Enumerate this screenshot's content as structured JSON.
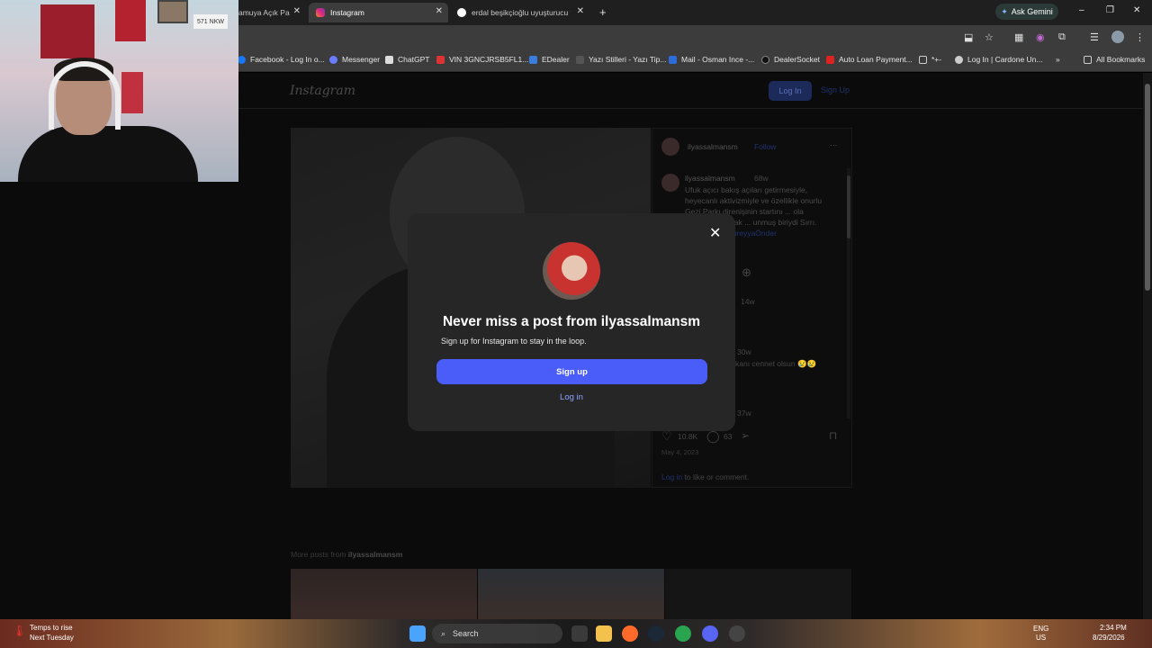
{
  "browser": {
    "tabs": [
      {
        "title": "amuya Açık Pa",
        "active": false
      },
      {
        "title": "Instagram",
        "active": true
      },
      {
        "title": "erdal beşikçioğlu uyuşturucu te",
        "active": false
      }
    ],
    "new_tab": "+",
    "ask_gemini": "Ask Gemini",
    "window_controls": {
      "minimize": "–",
      "restore": "❐",
      "close": "✕"
    },
    "bookmarks": [
      "Facebook - Log In o...",
      "Messenger",
      "ChatGPT",
      "VIN 3GNCJRSB5FL1...",
      "EDealer",
      "Yazı Stilleri - Yazı Tip...",
      "Mail - Osman Ince -...",
      "DealerSocket",
      "Auto Loan Payment...",
      "*+-",
      "Log In | Cardone Un..."
    ],
    "bookmarks_overflow": "»",
    "all_bookmarks": "All Bookmarks"
  },
  "instagram": {
    "logo": "Instagram",
    "login_button": "Log In",
    "signup_button": "Sign Up",
    "post": {
      "username": "ilyassalmansm",
      "follow": "Follow",
      "more": "···",
      "caption_user": "ilyassalmansm",
      "caption_age": "68w",
      "caption_text": "Ufuk açıcı bakış açıları getirmesiyle, heyecanlı aktivizmiyle ve özellikle onurlu Gezi Parkı direnişinin startını ... ola yadsınamayacak ... unmuş biriydi Sırrı. Yattığı",
      "hashtag": "#SırrıSüreyyaÖnder",
      "comment_age_1": "14w",
      "comment_age_2": "30w",
      "comment_text_2": "kanı cennet olsun 😢😢",
      "comment_age_3": "37w",
      "likes": "10.8K",
      "comments": "63",
      "date": "May 4, 2023",
      "login_prompt_link": "Log in",
      "login_prompt_rest": " to like or comment."
    },
    "more_posts_label": "More posts from ",
    "more_posts_user": "ilyassalmansm"
  },
  "modal": {
    "title": "Never miss a post from ilyassalmansm",
    "subtitle": "Sign up for Instagram to stay in the loop.",
    "signup": "Sign up",
    "login": "Log in",
    "close": "✕"
  },
  "taskbar": {
    "weather_line1": "Temps to rise",
    "weather_line2": "Next Tuesday",
    "search": "Search",
    "lang1": "ENG",
    "lang2": "US",
    "time": "2:34 PM",
    "date": "8/29/2026"
  },
  "webcam": {
    "plate": "571 NKW"
  }
}
